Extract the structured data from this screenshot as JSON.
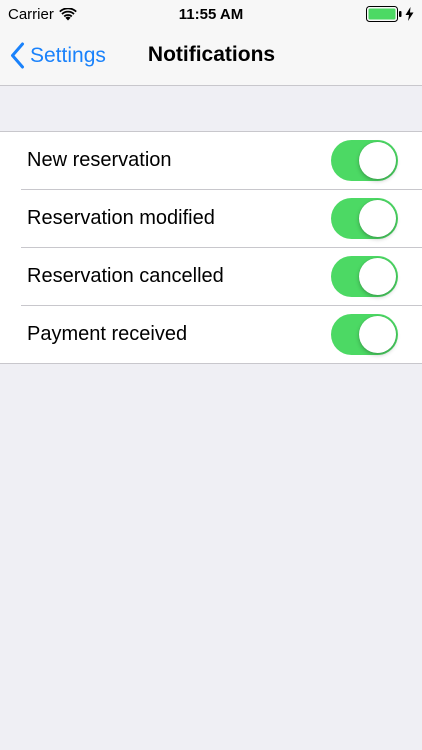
{
  "status_bar": {
    "carrier": "Carrier",
    "time": "11:55 AM",
    "icons": [
      "wifi-icon",
      "battery-icon",
      "charging-icon"
    ]
  },
  "nav": {
    "back_label": "Settings",
    "title": "Notifications",
    "back_icon": "chevron-left-icon"
  },
  "settings": {
    "rows": [
      {
        "label": "New reservation",
        "enabled": true
      },
      {
        "label": "Reservation modified",
        "enabled": true
      },
      {
        "label": "Reservation cancelled",
        "enabled": true
      },
      {
        "label": "Payment received",
        "enabled": true
      }
    ]
  },
  "colors": {
    "accent": "#1a82fb",
    "toggle_on": "#4cd964",
    "background": "#efeff4",
    "battery_fill": "#4cd964"
  }
}
